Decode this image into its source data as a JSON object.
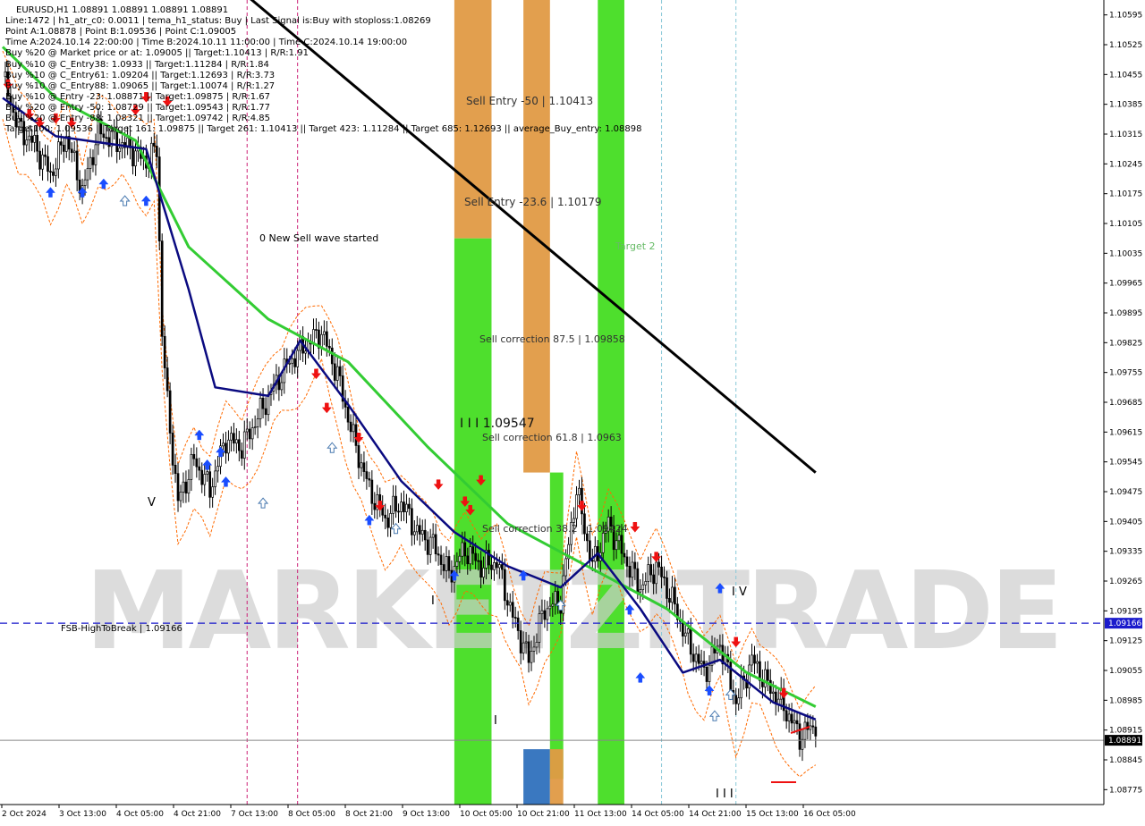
{
  "header": {
    "symbol_line": "EURUSD,H1  1.08891 1.08891 1.08891 1.08891",
    "lines": [
      "Line:1472 | h1_atr_c0: 0.0011 | tema_h1_status: Buy | Last Signal is:Buy with stoploss:1.08269",
      "Point A:1.08878 | Point B:1.09536 | Point C:1.09005",
      "Time A:2024.10.14 22:00:00 | Time B:2024.10.11 11:00:00 | Time C:2024.10.14 19:00:00",
      "Buy %20 @ Market price or at: 1.09005 || Target:1.10413 | R/R:1.91",
      "Buy %10 @ C_Entry38: 1.0933 || Target:1.11284 | R/R:1.84",
      "Buy %10 @ C_Entry61: 1.09204 || Target:1.12693 | R/R:3.73",
      "Buy %10 @ C_Entry88: 1.09065 || Target:1.10074 | R/R:1.27",
      "Buy %10 @ Entry -23: 1.08871 || Target:1.09875 | R/R:1.67",
      "Buy %20 @ Entry -50: 1.08729 || Target:1.09543 | R/R:1.77",
      "Buy %20 @ Entry -88: 1.08321 || Target:1.09742 | R/R:4.85",
      "Target100: 1.09536 || Target 161: 1.09875 || Target 261: 1.10413 || Target 423: 1.11284 || Target 685: 1.12693 || average_Buy_entry: 1.08898"
    ]
  },
  "price_axis": {
    "ticks": [
      "1.10595",
      "1.10525",
      "1.10455",
      "1.10385",
      "1.10315",
      "1.10245",
      "1.10175",
      "1.10105",
      "1.10035",
      "1.09965",
      "1.09895",
      "1.09825",
      "1.09755",
      "1.09685",
      "1.09615",
      "1.09545",
      "1.09475",
      "1.09405",
      "1.09335",
      "1.09265",
      "1.09195",
      "1.09125",
      "1.09055",
      "1.08985",
      "1.08915",
      "1.08845",
      "1.08775"
    ],
    "current_price": "1.08891",
    "break_price": "1.09166"
  },
  "time_axis": {
    "ticks": [
      "2 Oct 2024",
      "3 Oct 13:00",
      "4 Oct 05:00",
      "4 Oct 21:00",
      "7 Oct 13:00",
      "8 Oct 05:00",
      "8 Oct 21:00",
      "9 Oct 13:00",
      "10 Oct 05:00",
      "10 Oct 21:00",
      "11 Oct 13:00",
      "14 Oct 05:00",
      "14 Oct 21:00",
      "15 Oct 13:00",
      "16 Oct 05:00"
    ]
  },
  "annotations": {
    "sell_entry_50": "Sell Entry -50 | 1.10413",
    "sell_entry_23": "Sell Entry -23.6 | 1.10179",
    "new_sell_wave": "0 New Sell wave started",
    "sell_corr_875": "Sell correction 87.5 | 1.09858",
    "level_iii": "I I I 1.09547",
    "sell_corr_618": "Sell correction 61.8 | 1.0963",
    "sell_corr_382": "Sell correction 38.2 | 1.09424",
    "fsb_label": "FSB-HighToBreak | 1.09166",
    "target_partial": "Target 2",
    "wave_v": "V",
    "wave_iv": "I V",
    "wave_i": "I",
    "wave_ii": "I",
    "wave_iii_bottom": "I I I"
  },
  "watermark": "MARKETZITRADE",
  "colors": {
    "background": "#ffffff",
    "ma_green": "#33cc33",
    "ma_navy": "#0a0a80",
    "trend_black": "#000000",
    "band_orange": "#ff6a00",
    "zone_orange": "#e09a45",
    "zone_green": "#44dd22",
    "zone_blue": "#3a78c0",
    "arrow_up": "#1a4dff",
    "arrow_down": "#ee1111",
    "break_line": "#1a1acc",
    "price_tag_bg": "#000000"
  },
  "chart_data": {
    "type": "candlestick",
    "symbol": "EURUSD",
    "timeframe": "H1",
    "ylim": [
      1.0874,
      1.1063
    ],
    "close_path": [
      [
        0,
        1.1045
      ],
      [
        6,
        1.1033
      ],
      [
        12,
        1.1029
      ],
      [
        18,
        1.1022
      ],
      [
        24,
        1.1031
      ],
      [
        30,
        1.1018
      ],
      [
        36,
        1.1032
      ],
      [
        42,
        1.103
      ],
      [
        48,
        1.1028
      ],
      [
        54,
        1.1025
      ],
      [
        58,
        1.1028
      ],
      [
        60,
        1.0985
      ],
      [
        62,
        1.0968
      ],
      [
        66,
        1.0945
      ],
      [
        72,
        1.0955
      ],
      [
        78,
        1.0948
      ],
      [
        84,
        1.096
      ],
      [
        90,
        1.0958
      ],
      [
        96,
        1.0965
      ],
      [
        102,
        1.0972
      ],
      [
        108,
        1.0978
      ],
      [
        114,
        1.0982
      ],
      [
        120,
        1.0985
      ],
      [
        126,
        1.0975
      ],
      [
        132,
        1.096
      ],
      [
        138,
        1.0948
      ],
      [
        144,
        1.0941
      ],
      [
        150,
        1.0945
      ],
      [
        156,
        1.0938
      ],
      [
        162,
        1.0935
      ],
      [
        168,
        1.0928
      ],
      [
        174,
        1.0934
      ],
      [
        180,
        1.093
      ],
      [
        186,
        1.0931
      ],
      [
        192,
        1.0918
      ],
      [
        198,
        1.0908
      ],
      [
        204,
        1.092
      ],
      [
        210,
        1.0922
      ],
      [
        216,
        1.0948
      ],
      [
        222,
        1.093
      ],
      [
        228,
        1.094
      ],
      [
        234,
        1.0932
      ],
      [
        240,
        1.0925
      ],
      [
        246,
        1.093
      ],
      [
        252,
        1.0922
      ],
      [
        258,
        1.0912
      ],
      [
        264,
        1.0905
      ],
      [
        270,
        1.0912
      ],
      [
        276,
        1.0898
      ],
      [
        282,
        1.0908
      ],
      [
        288,
        1.0902
      ],
      [
        294,
        1.0897
      ],
      [
        300,
        1.089
      ],
      [
        306,
        1.0893
      ]
    ],
    "ma_slow": [
      [
        0,
        1.1052
      ],
      [
        20,
        1.104
      ],
      [
        50,
        1.103
      ],
      [
        70,
        1.1005
      ],
      [
        100,
        1.0988
      ],
      [
        130,
        1.0978
      ],
      [
        160,
        1.0958
      ],
      [
        190,
        1.094
      ],
      [
        220,
        1.093
      ],
      [
        250,
        1.092
      ],
      [
        280,
        1.0905
      ],
      [
        306,
        1.0897
      ]
    ],
    "ma_fast": [
      [
        0,
        1.104
      ],
      [
        20,
        1.1031
      ],
      [
        54,
        1.1028
      ],
      [
        70,
        1.0995
      ],
      [
        80,
        1.0972
      ],
      [
        100,
        1.097
      ],
      [
        112,
        1.0983
      ],
      [
        130,
        1.0968
      ],
      [
        150,
        1.095
      ],
      [
        170,
        1.0938
      ],
      [
        190,
        1.093
      ],
      [
        210,
        1.0925
      ],
      [
        224,
        1.0933
      ],
      [
        240,
        1.092
      ],
      [
        256,
        1.0905
      ],
      [
        270,
        1.0908
      ],
      [
        290,
        1.0898
      ],
      [
        306,
        1.0894
      ]
    ],
    "trendline": [
      [
        90,
        1.1065
      ],
      [
        306,
        1.0952
      ]
    ],
    "zones": [
      {
        "from": 170,
        "to": 184,
        "low": 1.1007,
        "high": 1.1063,
        "kind": "sell_entry"
      },
      {
        "from": 170,
        "to": 184,
        "low": 1.0874,
        "high": 1.1007,
        "kind": "correction"
      },
      {
        "from": 196,
        "to": 206,
        "low": 1.0952,
        "high": 1.1063,
        "kind": "sell_entry"
      },
      {
        "from": 206,
        "to": 211,
        "low": 1.088,
        "high": 1.0952,
        "kind": "correction"
      },
      {
        "from": 196,
        "to": 206,
        "low": 1.0874,
        "high": 1.0887,
        "kind": "blue"
      },
      {
        "from": 206,
        "to": 211,
        "low": 1.0874,
        "high": 1.0887,
        "kind": "sell_entry"
      },
      {
        "from": 224,
        "to": 234,
        "low": 1.0874,
        "high": 1.1063,
        "kind": "correction"
      }
    ],
    "dashed_red_bars": [
      92,
      111
    ],
    "dashed_blue_bars": [
      248,
      276
    ],
    "up_arrows": [
      [
        18,
        1.1022
      ],
      [
        30,
        1.1022
      ],
      [
        38,
        1.1024
      ],
      [
        54,
        1.102
      ],
      [
        74,
        1.0965
      ],
      [
        77,
        1.0958
      ],
      [
        82,
        1.0961
      ],
      [
        84,
        1.0954
      ],
      [
        138,
        1.0945
      ],
      [
        170,
        1.0932
      ],
      [
        196,
        1.0932
      ],
      [
        236,
        1.0924
      ],
      [
        240,
        1.0908
      ],
      [
        266,
        1.0905
      ],
      [
        270,
        1.0929
      ]
    ],
    "down_arrows": [
      [
        2,
        1.104
      ],
      [
        10,
        1.1033
      ],
      [
        14,
        1.1031
      ],
      [
        20,
        1.1032
      ],
      [
        26,
        1.1031
      ],
      [
        50,
        1.1034
      ],
      [
        54,
        1.1037
      ],
      [
        62,
        1.1036
      ],
      [
        118,
        1.0972
      ],
      [
        122,
        1.0964
      ],
      [
        134,
        1.0957
      ],
      [
        142,
        1.0941
      ],
      [
        164,
        1.0946
      ],
      [
        174,
        1.0942
      ],
      [
        180,
        1.0947
      ],
      [
        176,
        1.094
      ],
      [
        218,
        1.0941
      ],
      [
        238,
        1.0936
      ],
      [
        246,
        1.0929
      ],
      [
        276,
        1.0909
      ],
      [
        294,
        1.0897
      ]
    ],
    "hollow_arrows": [
      [
        46,
        1.102
      ],
      [
        98,
        1.0949
      ],
      [
        124,
        1.0962
      ],
      [
        148,
        1.0943
      ],
      [
        210,
        1.0925
      ],
      [
        268,
        1.0899
      ],
      [
        274,
        1.0904
      ]
    ]
  }
}
